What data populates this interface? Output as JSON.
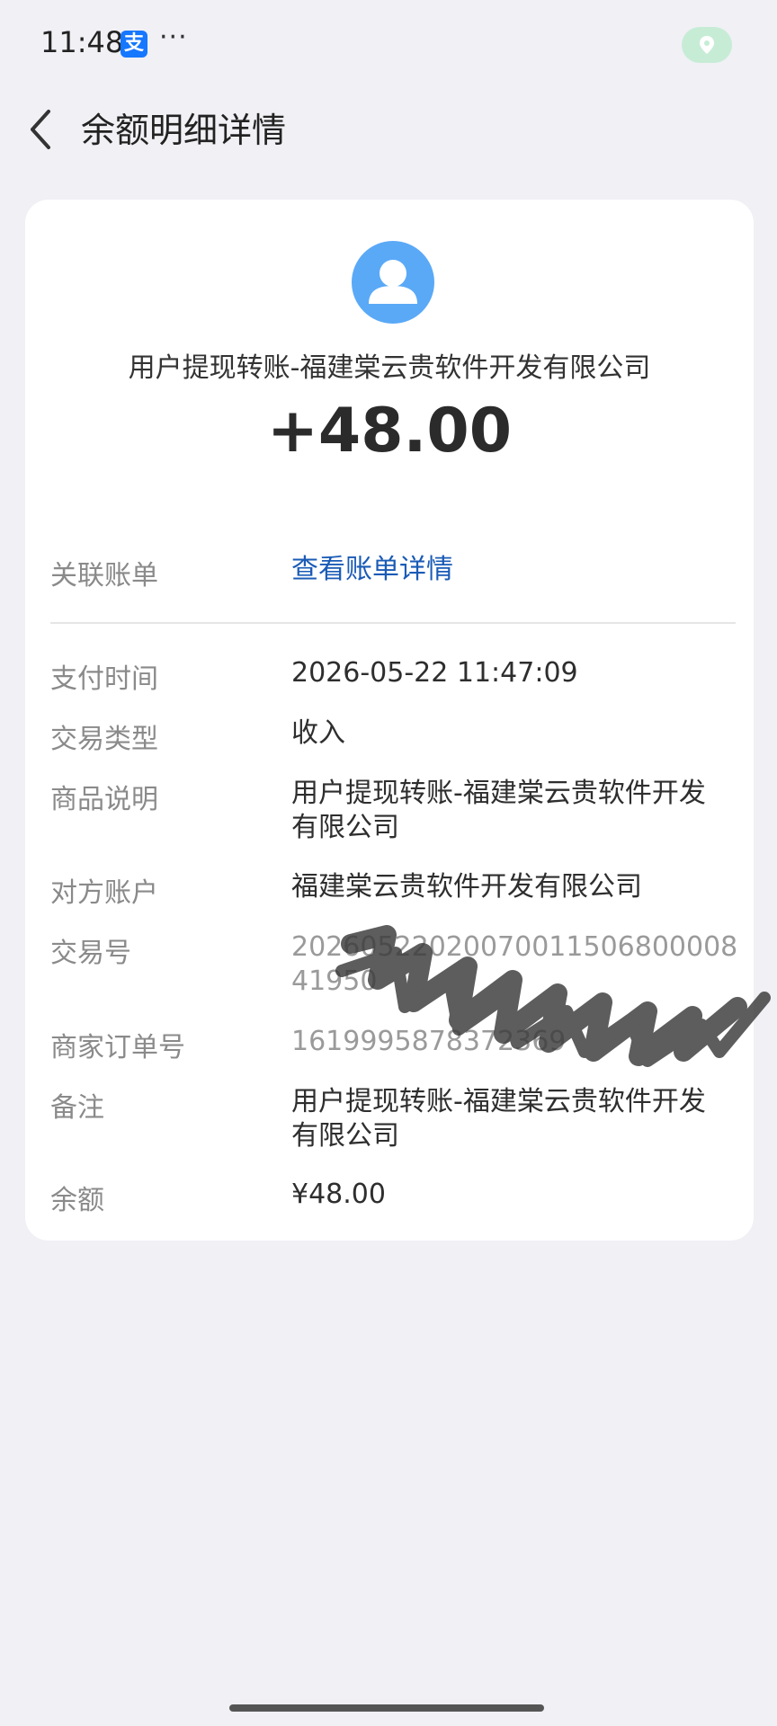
{
  "status_bar": {
    "time": "11:48",
    "app_badge": "支",
    "more": "···",
    "location_icon": "location-pin-icon"
  },
  "header": {
    "title": "余额明细详情",
    "back_icon": "chevron-left-icon"
  },
  "summary": {
    "avatar_icon": "user-avatar-icon",
    "payee": "用户提现转账-福建棠云贵软件开发有限公司",
    "amount": "+48.00"
  },
  "details": {
    "linked_bill": {
      "label": "关联账单",
      "value": "查看账单详情"
    },
    "pay_time": {
      "label": "支付时间",
      "value": "2026-05-22 11:47:09"
    },
    "trade_type": {
      "label": "交易类型",
      "value": "收入"
    },
    "goods_desc": {
      "label": "商品说明",
      "value": "用户提现转账-福建棠云贵软件开发有限公司"
    },
    "counterparty": {
      "label": "对方账户",
      "value": "福建棠云贵软件开发有限公司"
    },
    "trade_no": {
      "label": "交易号",
      "value": "2026052202007001150680000841950"
    },
    "merchant_order": {
      "label": "商家订单号",
      "value": "1619995878372369"
    },
    "remark": {
      "label": "备注",
      "value": "用户提现转账-福建棠云贵软件开发有限公司"
    },
    "balance": {
      "label": "余额",
      "value": "¥48.00"
    }
  },
  "colors": {
    "background": "#f0f0f5",
    "card": "#ffffff",
    "link": "#1a5bb6",
    "avatar": "#5aa9f7",
    "alipay_blue": "#1677ff"
  }
}
